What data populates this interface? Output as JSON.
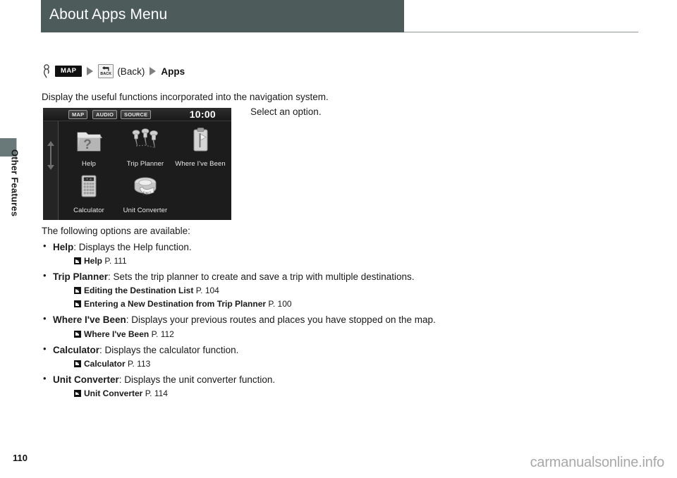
{
  "header": {
    "title": "About Apps Menu",
    "band_color": "#4d5b5b"
  },
  "sidebar": {
    "section_label": "Other Features",
    "tab_color": "#69797a"
  },
  "breadcrumb": {
    "hand_icon": "hand-pointer-icon",
    "map_button": "MAP",
    "back_button_label": "BACK",
    "back_icon": "return-arrow-icon",
    "back_text": "(Back)",
    "arrow_icon": "triangle-right-icon",
    "destination": "Apps"
  },
  "intro": "Display the useful functions incorporated into the navigation system.",
  "select_note": "Select an option.",
  "nav_screen": {
    "topbar": {
      "map": "MAP",
      "audio": "AUDIO",
      "source": "SOURCE",
      "clock": "10:00"
    },
    "scroll_up_icon": "scroll-up-arrow-icon",
    "scroll_down_icon": "scroll-down-arrow-icon",
    "items": [
      {
        "label": "Help",
        "icon": "help-folder-icon"
      },
      {
        "label": "Trip Planner",
        "icon": "pushpins-icon"
      },
      {
        "label": "Where I've Been",
        "icon": "clipboard-flag-icon"
      },
      {
        "label": "Calculator",
        "icon": "calculator-icon"
      },
      {
        "label": "Unit Converter",
        "icon": "tape-measure-icon"
      }
    ]
  },
  "options": {
    "lead": "The following options are available:",
    "items": [
      {
        "term": "Help",
        "desc": ": Displays the Help function.",
        "refs": [
          {
            "title": "Help",
            "page": "P. 111"
          }
        ]
      },
      {
        "term": "Trip Planner",
        "desc": ": Sets the trip planner to create and save a trip with multiple destinations.",
        "refs": [
          {
            "title": "Editing the Destination List",
            "page": "P. 104"
          },
          {
            "title": "Entering a New Destination from Trip Planner",
            "page": "P. 100"
          }
        ]
      },
      {
        "term": "Where I've Been",
        "desc": ": Displays your previous routes and places you have stopped on the map.",
        "refs": [
          {
            "title": "Where I've Been",
            "page": "P. 112"
          }
        ]
      },
      {
        "term": "Calculator",
        "desc": ": Displays the calculator function.",
        "refs": [
          {
            "title": "Calculator",
            "page": "P. 113"
          }
        ]
      },
      {
        "term": "Unit Converter",
        "desc": ": Displays the unit converter function.",
        "refs": [
          {
            "title": "Unit Converter",
            "page": "P. 114"
          }
        ]
      }
    ]
  },
  "footer": {
    "page_number": "110",
    "watermark": "carmanualsonline.info"
  }
}
